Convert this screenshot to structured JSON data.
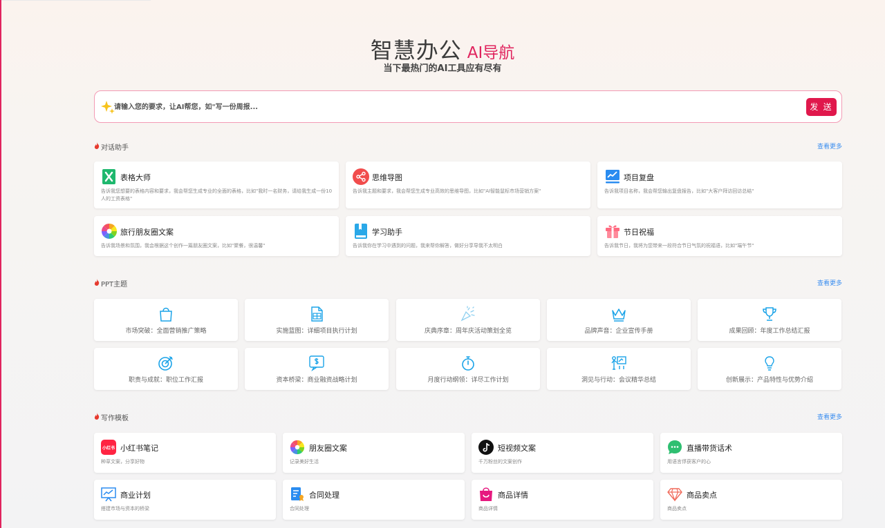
{
  "hero": {
    "title_main": "智慧办公",
    "title_ai": "AI导航",
    "subtitle": "当下最热门的AI工具应有尽有"
  },
  "search": {
    "placeholder": "请输入您的要求，让AI帮您，如\"写一份周报...",
    "send_label": "发 送"
  },
  "sections": {
    "chat": {
      "title": "对话助手",
      "more": "查看更多"
    },
    "ppt": {
      "title": "PPT主题",
      "more": "查看更多"
    },
    "writing": {
      "title": "写作模板",
      "more": "查看更多"
    }
  },
  "chat_cards": [
    {
      "name": "表格大师",
      "desc": "告诉我您想要的表格内容和要求，我会帮您生成专业的全面的表格，比如\"我时一名财务，请给我生成一份10人的工资表格\"",
      "icon": "excel-icon"
    },
    {
      "name": "思维导图",
      "desc": "告诉我主题和要求，我会帮您生成专业高效的思维导图，比如\"AI智能鼠标市场营销方案\"",
      "icon": "mindmap-icon"
    },
    {
      "name": "项目复盘",
      "desc": "告诉我项目名称，我会帮您输出复盘报告，比如\"大客户拜访回访总结\"",
      "icon": "chart-board-icon"
    },
    {
      "name": "旅行朋友圈文案",
      "desc": "告诉我场景和氛围，我会根据这个创作一篇朋友圈文案，比如\"聚餐，很温馨\"",
      "icon": "pinwheel-icon"
    },
    {
      "name": "学习助手",
      "desc": "告诉我你在学习中遇到的问题，我来帮你解答，做好分享导我不太明白",
      "icon": "book-icon"
    },
    {
      "name": "节日祝福",
      "desc": "告诉我节日，我将为您带来一段符合节日气氛的祝福语，比如\"端午节\"",
      "icon": "gift-icon"
    }
  ],
  "ppt_cards": [
    {
      "label": "市场突破：全面营销推广策略",
      "icon": "shopping-bag-icon"
    },
    {
      "label": "实施蓝图：详细项目执行计划",
      "icon": "document-table-icon"
    },
    {
      "label": "庆典序章：周年庆活动策划全览",
      "icon": "party-popper-icon"
    },
    {
      "label": "品牌声音：企业宣传手册",
      "icon": "crown-icon"
    },
    {
      "label": "成果回顾：年度工作总结汇报",
      "icon": "trophy-icon"
    },
    {
      "label": "职责与成就：职位工作汇报",
      "icon": "target-icon"
    },
    {
      "label": "资本桥梁：商业融资战略计划",
      "icon": "money-chat-icon"
    },
    {
      "label": "月度行动纲领：详尽工作计划",
      "icon": "stopwatch-icon"
    },
    {
      "label": "洞见与行动：会议精华总结",
      "icon": "meeting-board-icon"
    },
    {
      "label": "创新展示：产品特性与优势介绍",
      "icon": "lightbulb-icon"
    }
  ],
  "writing_cards": [
    {
      "name": "小红书笔记",
      "desc": "种草文案，分享好物",
      "icon": "xiaohongshu-icon",
      "icon_text": "小红书"
    },
    {
      "name": "朋友圈文案",
      "desc": "记录美好生活",
      "icon": "pinwheel-icon"
    },
    {
      "name": "短视频文案",
      "desc": "千万粉丝的文案创作",
      "icon": "tiktok-icon"
    },
    {
      "name": "直播带货话术",
      "desc": "用语言俘获客户的心",
      "icon": "chat-bubble-icon"
    },
    {
      "name": "商业计划",
      "desc": "搭建市场与资本的桥梁",
      "icon": "presentation-icon"
    },
    {
      "name": "合同处理",
      "desc": "合同处理",
      "icon": "contract-icon"
    },
    {
      "name": "商品详情",
      "desc": "商品详情",
      "icon": "shopping-bag-pink-icon"
    },
    {
      "name": "商品卖点",
      "desc": "商品卖点",
      "icon": "diamond-icon"
    }
  ],
  "colors": {
    "accent": "#e0184c",
    "link": "#3b8ef0",
    "icon_blue": "#1aa3e8"
  }
}
